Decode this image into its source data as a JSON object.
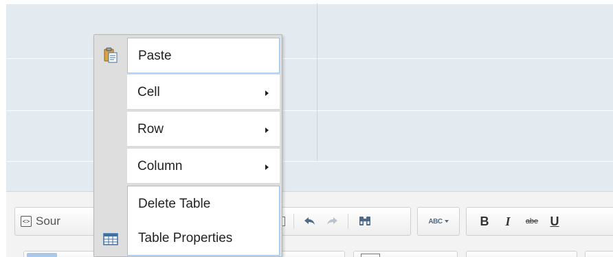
{
  "context_menu": {
    "items": [
      {
        "label": "Paste",
        "icon": "paste-icon",
        "has_submenu": false
      },
      {
        "label": "Cell",
        "icon": "",
        "has_submenu": true
      },
      {
        "label": "Row",
        "icon": "",
        "has_submenu": true
      },
      {
        "label": "Column",
        "icon": "",
        "has_submenu": true
      },
      {
        "label": "Delete Table",
        "icon": "",
        "has_submenu": false
      },
      {
        "label": "Table Properties",
        "icon": "table-icon",
        "has_submenu": false
      }
    ]
  },
  "toolbar": {
    "source_label": "Sour",
    "buttons": [
      "source-icon",
      "paste-text-icon",
      "undo-icon",
      "redo-icon",
      "find-icon",
      "spellcheck-icon",
      "bold-icon",
      "italic-icon",
      "strikethrough-icon",
      "underline-icon"
    ],
    "bold_glyph": "B",
    "italic_glyph": "I",
    "strike_glyph": "abe",
    "underline_glyph": "U",
    "spell_glyph": "ABC"
  },
  "colors": {
    "table_cell": "#e4ebf0",
    "menu_hover_border": "#9dc0e9",
    "icon_blue": "#4f6a86"
  }
}
